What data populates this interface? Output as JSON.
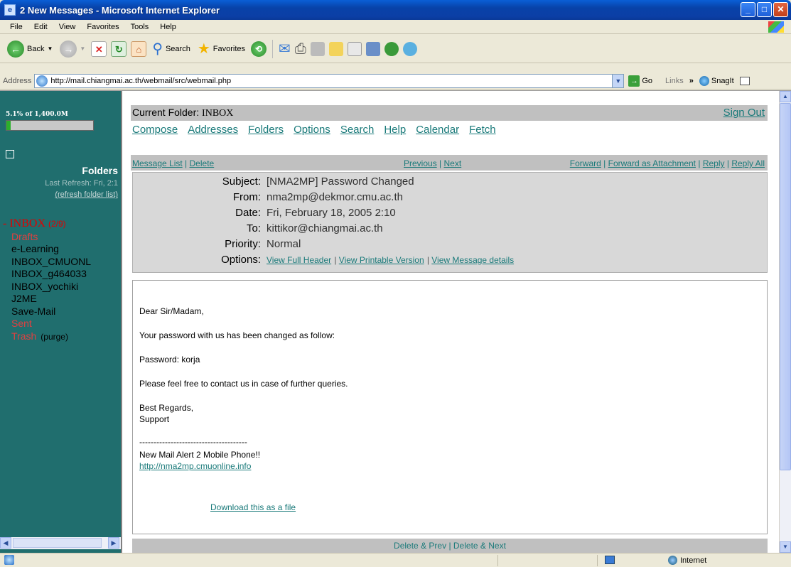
{
  "window": {
    "title": "2 New Messages - Microsoft Internet Explorer"
  },
  "menu": [
    "File",
    "Edit",
    "View",
    "Favorites",
    "Tools",
    "Help"
  ],
  "toolbar": {
    "back": "Back",
    "search": "Search",
    "favorites": "Favorites"
  },
  "address": {
    "label": "Address",
    "url": "http://mail.chiangmai.ac.th/webmail/src/webmail.php",
    "go": "Go",
    "links": "Links",
    "chevron": "»",
    "snagit": "SnagIt"
  },
  "sidebar": {
    "quota_text": "5.1% of 1,400.0M",
    "quota_fraction": 0.051,
    "toggle": "·",
    "folders_title": "Folders",
    "last_refresh": "Last Refresh: Fri, 2:1",
    "refresh_link": "(refresh folder list)",
    "inbox_label": "INBOX",
    "inbox_count": "(2/9)",
    "folders": [
      "Drafts",
      "e-Learning",
      "INBOX_CMUONL",
      "INBOX_g464033",
      "INBOX_yochiki",
      "J2ME",
      "Save-Mail",
      "Sent",
      "Trash"
    ],
    "purge": "(purge)"
  },
  "main": {
    "current_folder_label": "Current Folder:",
    "current_folder": "INBOX",
    "sign_out": "Sign Out",
    "nav": [
      "Compose",
      "Addresses",
      "Folders",
      "Options",
      "Search",
      "Help",
      "Calendar",
      "Fetch"
    ],
    "actions": {
      "message_list": "Message List",
      "delete": "Delete",
      "previous": "Previous",
      "next": "Next",
      "forward": "Forward",
      "forward_attachment": "Forward as Attachment",
      "reply": "Reply",
      "reply_all": "Reply All"
    },
    "headers": {
      "subject_label": "Subject:",
      "subject": "[NMA2MP] Password Changed",
      "from_label": "From:",
      "from": "nma2mp@dekmor.cmu.ac.th",
      "date_label": "Date:",
      "date": "Fri, February 18, 2005 2:10",
      "to_label": "To:",
      "to": "kittikor@chiangmai.ac.th",
      "priority_label": "Priority:",
      "priority": "Normal",
      "options_label": "Options:",
      "opt_full_header": "View Full Header",
      "opt_printable": "View Printable Version",
      "opt_details": "View Message details"
    },
    "body": {
      "greeting": "Dear Sir/Madam,",
      "line1": "Your password with us has been changed as follow:",
      "line2": "Password: korja",
      "line3": "Please feel free to contact us in case of further queries.",
      "regards": "Best Regards,",
      "signature": "Support",
      "divider": "--------------------------------------",
      "alert": "New Mail Alert 2 Mobile Phone!!",
      "link": "http://nma2mp.cmuonline.info",
      "download": "Download this as a file"
    },
    "bottom": {
      "delete_prev": "Delete & Prev",
      "delete_next": "Delete & Next"
    }
  },
  "status": {
    "zone": "Internet"
  }
}
